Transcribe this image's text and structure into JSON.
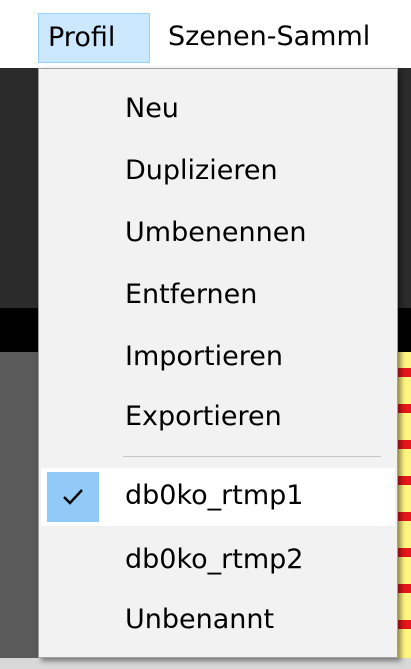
{
  "menubar": {
    "items": [
      {
        "label": "Profil"
      },
      {
        "label": "Szenen-Samml"
      }
    ]
  },
  "profil_menu": {
    "actions": [
      {
        "label": "Neu"
      },
      {
        "label": "Duplizieren"
      },
      {
        "label": "Umbenennen"
      },
      {
        "label": "Entfernen"
      },
      {
        "label": "Importieren"
      },
      {
        "label": "Exportieren"
      }
    ],
    "profiles": [
      {
        "label": "db0ko_rtmp1",
        "checked": true
      },
      {
        "label": "db0ko_rtmp2",
        "checked": false
      },
      {
        "label": "Unbenannt",
        "checked": false
      }
    ]
  },
  "colors": {
    "menubar_highlight": "#cce8ff",
    "menu_background": "#f2f2f2",
    "check_background": "#91c9f7"
  },
  "icons": {
    "check": "checkmark-icon"
  }
}
